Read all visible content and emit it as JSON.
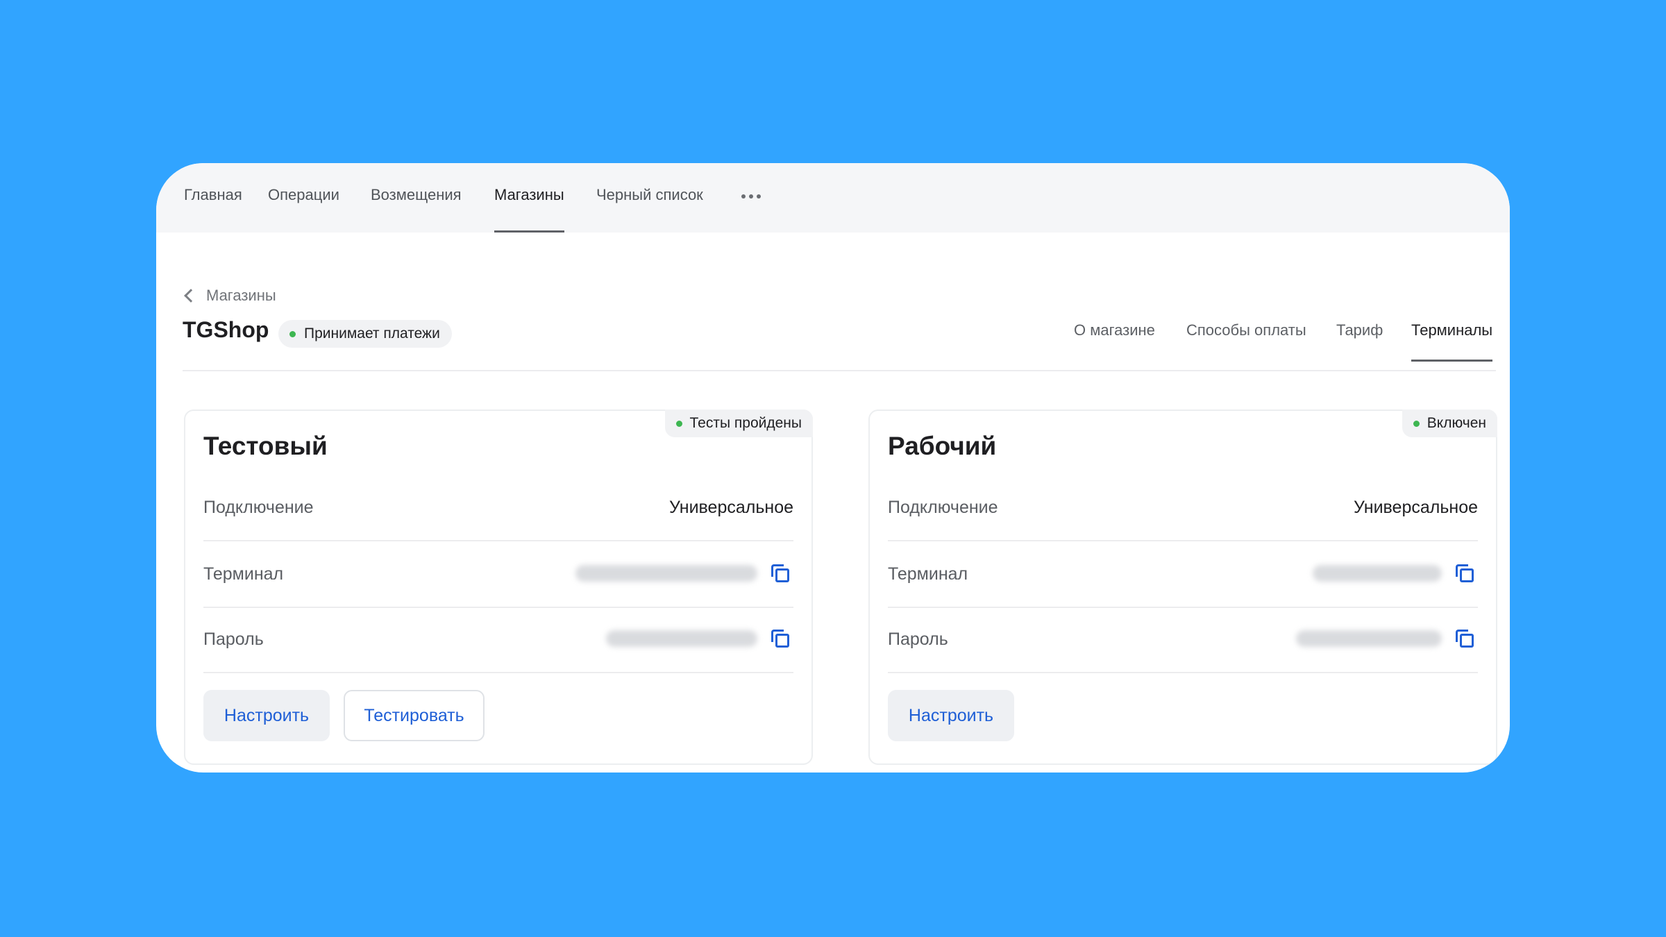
{
  "colors": {
    "background": "#31a4ff",
    "accent": "#1f5fd6",
    "status_green": "#3db651"
  },
  "nav": {
    "items": [
      {
        "label": "Главная"
      },
      {
        "label": "Операции"
      },
      {
        "label": "Возмещения"
      },
      {
        "label": "Магазины",
        "active": true
      },
      {
        "label": "Черный список"
      }
    ],
    "more_icon": "more-dots-icon"
  },
  "breadcrumb": {
    "back_label": "Магазины",
    "icon": "chevron-left-icon"
  },
  "shop": {
    "name": "TGShop",
    "status": "Принимает платежи",
    "tabs": [
      {
        "label": "О магазине"
      },
      {
        "label": "Способы оплаты"
      },
      {
        "label": "Тариф"
      },
      {
        "label": "Терминалы",
        "active": true
      }
    ]
  },
  "terminals": [
    {
      "title": "Тестовый",
      "badge": "Тесты пройдены",
      "rows": [
        {
          "label": "Подключение",
          "value": "Универсальное"
        },
        {
          "label": "Терминал",
          "value_hidden": true
        },
        {
          "label": "Пароль",
          "value_hidden": true
        }
      ],
      "buttons": [
        {
          "label": "Настроить"
        },
        {
          "label": "Тестировать"
        }
      ]
    },
    {
      "title": "Рабочий",
      "badge": "Включен",
      "rows": [
        {
          "label": "Подключение",
          "value": "Универсальное"
        },
        {
          "label": "Терминал",
          "value_hidden": true
        },
        {
          "label": "Пароль",
          "value_hidden": true
        }
      ],
      "buttons": [
        {
          "label": "Настроить"
        }
      ]
    }
  ]
}
